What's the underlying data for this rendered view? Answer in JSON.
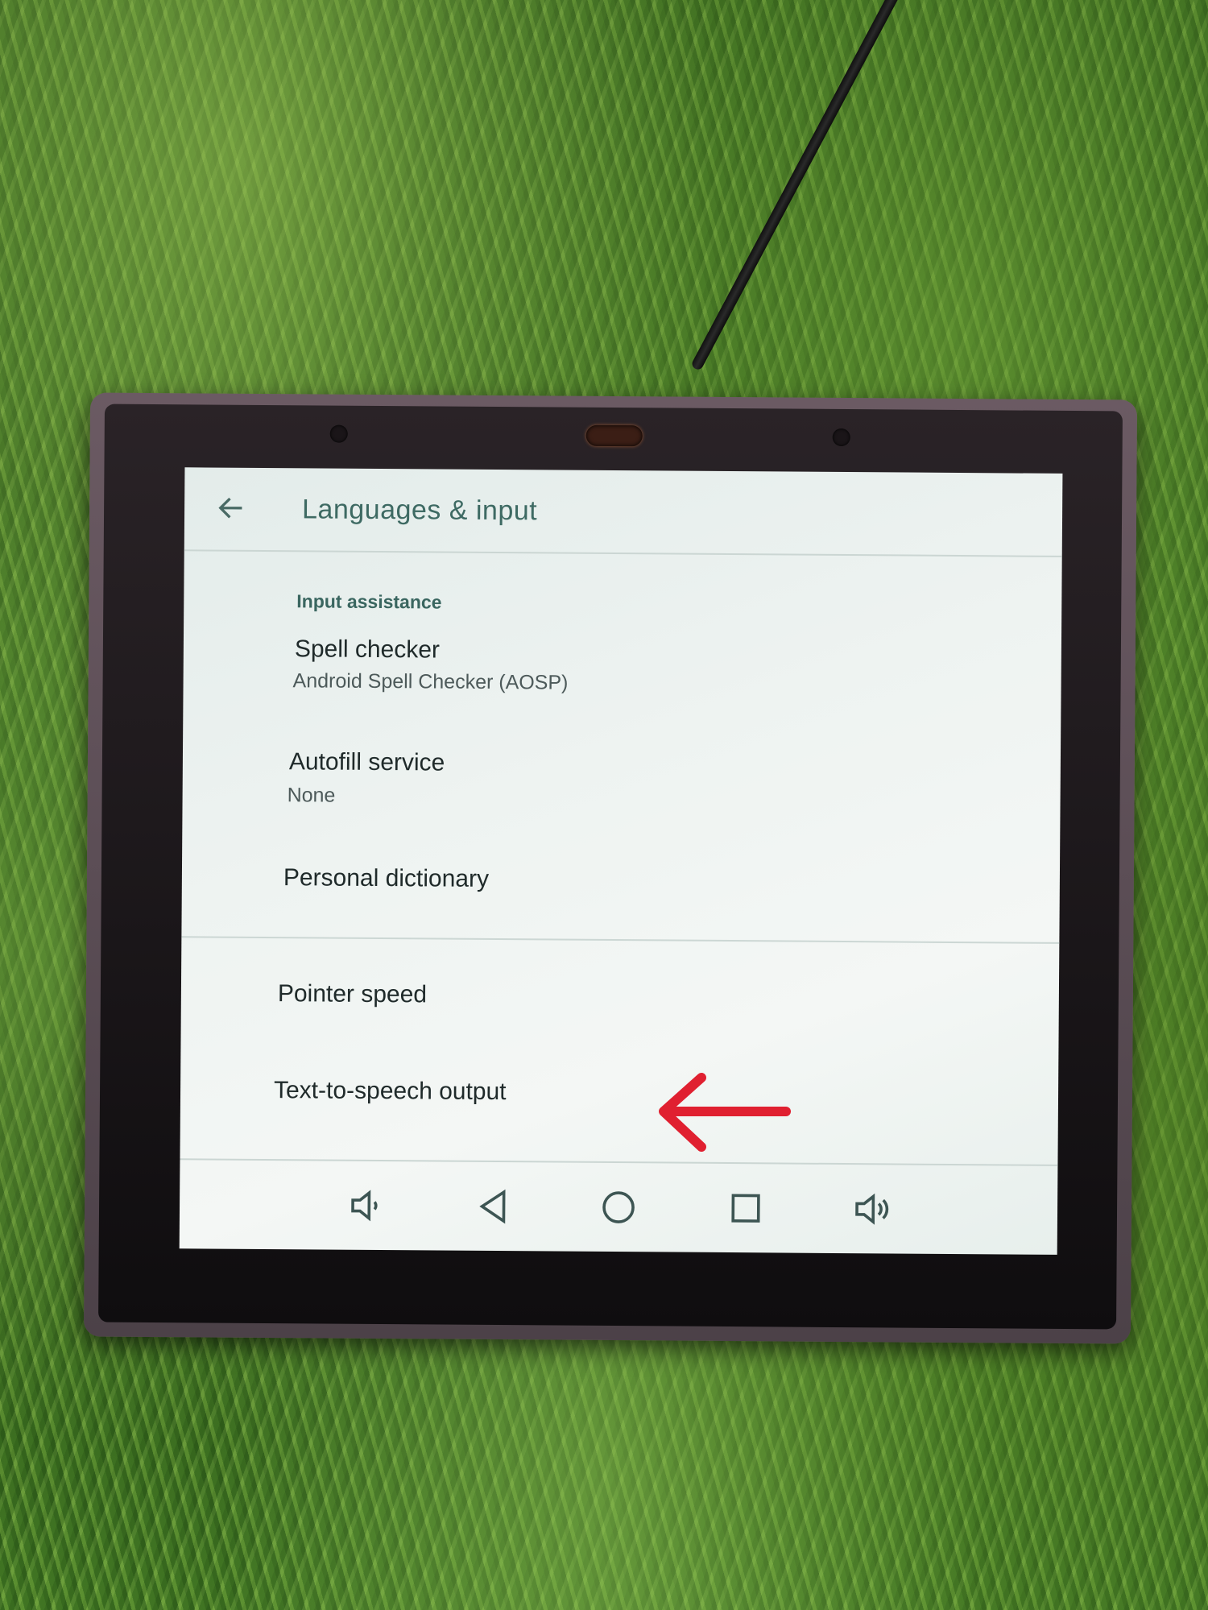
{
  "screen": {
    "title": "Languages & input",
    "section_header": "Input assistance",
    "items": [
      {
        "title": "Spell checker",
        "subtitle": "Android Spell Checker (AOSP)"
      },
      {
        "title": "Autofill service",
        "subtitle": "None"
      },
      {
        "title": "Personal dictionary"
      },
      {
        "title": "Pointer speed"
      },
      {
        "title": "Text-to-speech output"
      }
    ]
  },
  "navbar": {
    "icons": [
      "volume-down-icon",
      "back-icon",
      "home-icon",
      "recents-icon",
      "volume-up-icon"
    ]
  },
  "colors": {
    "accent_title": "#3e6a63",
    "annotation_arrow": "#e02030"
  }
}
